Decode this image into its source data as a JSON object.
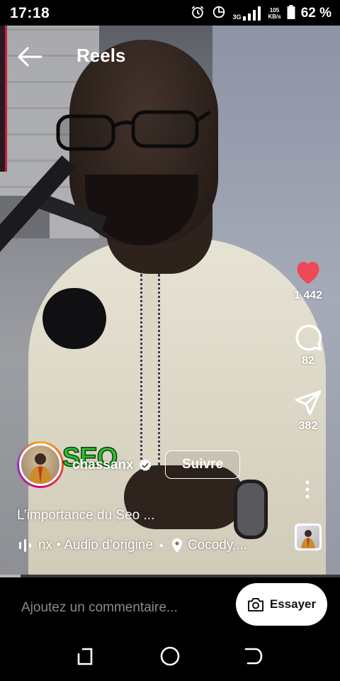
{
  "status_bar": {
    "time": "17:18",
    "network": "3G",
    "speed_value": "105",
    "speed_unit": "KB/s",
    "battery": "62 %",
    "icons": [
      "alarm-icon",
      "data-saver-icon",
      "signal-icon",
      "battery-icon"
    ]
  },
  "header": {
    "title": "Reels",
    "back_icon": "arrow-left-icon"
  },
  "actions": {
    "like_count": "1 442",
    "comment_count": "82",
    "share_count": "382",
    "like_color": "#ed4956",
    "more_icon": "more-vertical-icon"
  },
  "author": {
    "badge_text": "SEO",
    "username": "chassanx",
    "verified": true,
    "follow_label": "Suivre"
  },
  "post": {
    "caption": "L’importance du Seo ...",
    "audio": "nx • Audio d’origine",
    "location": "Cocody,..."
  },
  "playback": {
    "progress_percent": 6
  },
  "comment_bar": {
    "placeholder": "Ajoutez un commentaire...",
    "try_label": "Essayer"
  },
  "system_nav": {
    "icons": [
      "recents-icon",
      "home-icon",
      "back-icon"
    ]
  }
}
